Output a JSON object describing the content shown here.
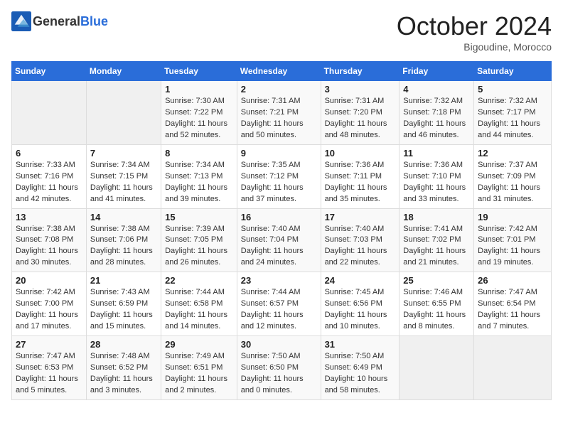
{
  "header": {
    "logo_general": "General",
    "logo_blue": "Blue",
    "month": "October 2024",
    "location": "Bigoudine, Morocco"
  },
  "days_of_week": [
    "Sunday",
    "Monday",
    "Tuesday",
    "Wednesday",
    "Thursday",
    "Friday",
    "Saturday"
  ],
  "weeks": [
    [
      {
        "day": "",
        "info": ""
      },
      {
        "day": "",
        "info": ""
      },
      {
        "day": "1",
        "info": "Sunrise: 7:30 AM\nSunset: 7:22 PM\nDaylight: 11 hours and 52 minutes."
      },
      {
        "day": "2",
        "info": "Sunrise: 7:31 AM\nSunset: 7:21 PM\nDaylight: 11 hours and 50 minutes."
      },
      {
        "day": "3",
        "info": "Sunrise: 7:31 AM\nSunset: 7:20 PM\nDaylight: 11 hours and 48 minutes."
      },
      {
        "day": "4",
        "info": "Sunrise: 7:32 AM\nSunset: 7:18 PM\nDaylight: 11 hours and 46 minutes."
      },
      {
        "day": "5",
        "info": "Sunrise: 7:32 AM\nSunset: 7:17 PM\nDaylight: 11 hours and 44 minutes."
      }
    ],
    [
      {
        "day": "6",
        "info": "Sunrise: 7:33 AM\nSunset: 7:16 PM\nDaylight: 11 hours and 42 minutes."
      },
      {
        "day": "7",
        "info": "Sunrise: 7:34 AM\nSunset: 7:15 PM\nDaylight: 11 hours and 41 minutes."
      },
      {
        "day": "8",
        "info": "Sunrise: 7:34 AM\nSunset: 7:13 PM\nDaylight: 11 hours and 39 minutes."
      },
      {
        "day": "9",
        "info": "Sunrise: 7:35 AM\nSunset: 7:12 PM\nDaylight: 11 hours and 37 minutes."
      },
      {
        "day": "10",
        "info": "Sunrise: 7:36 AM\nSunset: 7:11 PM\nDaylight: 11 hours and 35 minutes."
      },
      {
        "day": "11",
        "info": "Sunrise: 7:36 AM\nSunset: 7:10 PM\nDaylight: 11 hours and 33 minutes."
      },
      {
        "day": "12",
        "info": "Sunrise: 7:37 AM\nSunset: 7:09 PM\nDaylight: 11 hours and 31 minutes."
      }
    ],
    [
      {
        "day": "13",
        "info": "Sunrise: 7:38 AM\nSunset: 7:08 PM\nDaylight: 11 hours and 30 minutes."
      },
      {
        "day": "14",
        "info": "Sunrise: 7:38 AM\nSunset: 7:06 PM\nDaylight: 11 hours and 28 minutes."
      },
      {
        "day": "15",
        "info": "Sunrise: 7:39 AM\nSunset: 7:05 PM\nDaylight: 11 hours and 26 minutes."
      },
      {
        "day": "16",
        "info": "Sunrise: 7:40 AM\nSunset: 7:04 PM\nDaylight: 11 hours and 24 minutes."
      },
      {
        "day": "17",
        "info": "Sunrise: 7:40 AM\nSunset: 7:03 PM\nDaylight: 11 hours and 22 minutes."
      },
      {
        "day": "18",
        "info": "Sunrise: 7:41 AM\nSunset: 7:02 PM\nDaylight: 11 hours and 21 minutes."
      },
      {
        "day": "19",
        "info": "Sunrise: 7:42 AM\nSunset: 7:01 PM\nDaylight: 11 hours and 19 minutes."
      }
    ],
    [
      {
        "day": "20",
        "info": "Sunrise: 7:42 AM\nSunset: 7:00 PM\nDaylight: 11 hours and 17 minutes."
      },
      {
        "day": "21",
        "info": "Sunrise: 7:43 AM\nSunset: 6:59 PM\nDaylight: 11 hours and 15 minutes."
      },
      {
        "day": "22",
        "info": "Sunrise: 7:44 AM\nSunset: 6:58 PM\nDaylight: 11 hours and 14 minutes."
      },
      {
        "day": "23",
        "info": "Sunrise: 7:44 AM\nSunset: 6:57 PM\nDaylight: 11 hours and 12 minutes."
      },
      {
        "day": "24",
        "info": "Sunrise: 7:45 AM\nSunset: 6:56 PM\nDaylight: 11 hours and 10 minutes."
      },
      {
        "day": "25",
        "info": "Sunrise: 7:46 AM\nSunset: 6:55 PM\nDaylight: 11 hours and 8 minutes."
      },
      {
        "day": "26",
        "info": "Sunrise: 7:47 AM\nSunset: 6:54 PM\nDaylight: 11 hours and 7 minutes."
      }
    ],
    [
      {
        "day": "27",
        "info": "Sunrise: 7:47 AM\nSunset: 6:53 PM\nDaylight: 11 hours and 5 minutes."
      },
      {
        "day": "28",
        "info": "Sunrise: 7:48 AM\nSunset: 6:52 PM\nDaylight: 11 hours and 3 minutes."
      },
      {
        "day": "29",
        "info": "Sunrise: 7:49 AM\nSunset: 6:51 PM\nDaylight: 11 hours and 2 minutes."
      },
      {
        "day": "30",
        "info": "Sunrise: 7:50 AM\nSunset: 6:50 PM\nDaylight: 11 hours and 0 minutes."
      },
      {
        "day": "31",
        "info": "Sunrise: 7:50 AM\nSunset: 6:49 PM\nDaylight: 10 hours and 58 minutes."
      },
      {
        "day": "",
        "info": ""
      },
      {
        "day": "",
        "info": ""
      }
    ]
  ]
}
